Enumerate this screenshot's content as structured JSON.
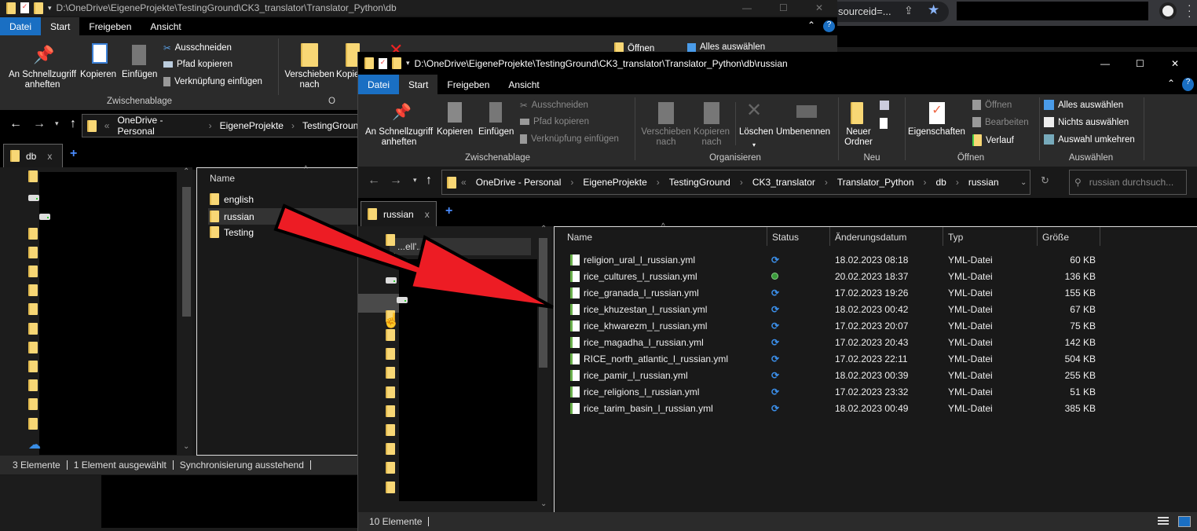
{
  "browser": {
    "url_fragment": "sourceid=...",
    "icons": [
      "share-icon",
      "star-icon",
      "avatar",
      "menu-dots-icon"
    ],
    "star_color": "#8ab4f8"
  },
  "back_window": {
    "title": "D:\\OneDrive\\EigeneProjekte\\TestingGround\\CK3_translator\\Translator_Python\\db",
    "tabs": [
      "Datei",
      "Start",
      "Freigeben",
      "Ansicht"
    ],
    "ribbon": {
      "pin": "An Schnellzugriff anheften",
      "copy": "Kopieren",
      "paste": "Einfügen",
      "cut": "Ausschneiden",
      "copy_path": "Pfad kopieren",
      "paste_shortcut": "Verknüpfung einfügen",
      "group_clipboard": "Zwischenablage",
      "move": "Verschieben nach",
      "copy_to": "Kopie",
      "group_org": "O",
      "open": "Öffnen",
      "select_all": "Alles auswählen"
    },
    "breadcrumb": [
      "OneDrive - Personal",
      "EigeneProjekte",
      "TestingGround"
    ],
    "tab_label": "db",
    "name_header": "Name",
    "items": [
      "english",
      "russian",
      "Testing"
    ],
    "selected_item": "russian",
    "status": [
      "3 Elemente",
      "1 Element ausgewählt",
      "Synchronisierung ausstehend"
    ]
  },
  "front_window": {
    "title": "D:\\OneDrive\\EigeneProjekte\\TestingGround\\CK3_translator\\Translator_Python\\db\\russian",
    "tabs": [
      "Datei",
      "Start",
      "Freigeben",
      "Ansicht"
    ],
    "ribbon": {
      "pin": "An Schnellzugriff anheften",
      "copy": "Kopieren",
      "paste": "Einfügen",
      "cut": "Ausschneiden",
      "copy_path": "Pfad kopieren",
      "paste_shortcut": "Verknüpfung einfügen",
      "group_clipboard": "Zwischenablage",
      "move": "Verschieben nach",
      "copy_to": "Kopieren nach",
      "delete": "Löschen",
      "rename": "Umbenennen",
      "group_org": "Organisieren",
      "new_folder": "Neuer Ordner",
      "group_new": "Neu",
      "properties": "Eigenschaften",
      "open": "Öffnen",
      "edit": "Bearbeiten",
      "history": "Verlauf",
      "group_open": "Öffnen",
      "select_all": "Alles auswählen",
      "select_none": "Nichts auswählen",
      "invert": "Auswahl umkehren",
      "group_select": "Auswählen"
    },
    "breadcrumb": [
      "OneDrive - Personal",
      "EigeneProjekte",
      "TestingGround",
      "CK3_translator",
      "Translator_Python",
      "db",
      "russian"
    ],
    "search_placeholder": "russian durchsuch...",
    "tab_label": "russian",
    "nav_partial": "...ell'...iff",
    "columns": [
      "Name",
      "Status",
      "Änderungsdatum",
      "Typ",
      "Größe"
    ],
    "files": [
      {
        "name": "religion_ural_l_russian.yml",
        "status": "sync-pending",
        "date": "18.02.2023 08:18",
        "type": "YML-Datei",
        "size": "60 KB"
      },
      {
        "name": "rice_cultures_l_russian.yml",
        "status": "synced",
        "date": "20.02.2023 18:37",
        "type": "YML-Datei",
        "size": "136 KB"
      },
      {
        "name": "rice_granada_l_russian.yml",
        "status": "sync-pending",
        "date": "17.02.2023 19:26",
        "type": "YML-Datei",
        "size": "155 KB"
      },
      {
        "name": "rice_khuzestan_l_russian.yml",
        "status": "sync-pending",
        "date": "18.02.2023 00:42",
        "type": "YML-Datei",
        "size": "67 KB"
      },
      {
        "name": "rice_khwarezm_l_russian.yml",
        "status": "sync-pending",
        "date": "17.02.2023 20:07",
        "type": "YML-Datei",
        "size": "75 KB"
      },
      {
        "name": "rice_magadha_l_russian.yml",
        "status": "sync-pending",
        "date": "17.02.2023 20:43",
        "type": "YML-Datei",
        "size": "142 KB"
      },
      {
        "name": "RICE_north_atlantic_l_russian.yml",
        "status": "sync-pending",
        "date": "17.02.2023 22:11",
        "type": "YML-Datei",
        "size": "504 KB"
      },
      {
        "name": "rice_pamir_l_russian.yml",
        "status": "sync-pending",
        "date": "18.02.2023 00:39",
        "type": "YML-Datei",
        "size": "255 KB"
      },
      {
        "name": "rice_religions_l_russian.yml",
        "status": "sync-pending",
        "date": "17.02.2023 23:32",
        "type": "YML-Datei",
        "size": "51 KB"
      },
      {
        "name": "rice_tarim_basin_l_russian.yml",
        "status": "sync-pending",
        "date": "18.02.2023 00:49",
        "type": "YML-Datei",
        "size": "385 KB"
      }
    ],
    "status": "10 Elemente"
  },
  "annotation": {
    "arrow_color": "#ed1c24"
  }
}
